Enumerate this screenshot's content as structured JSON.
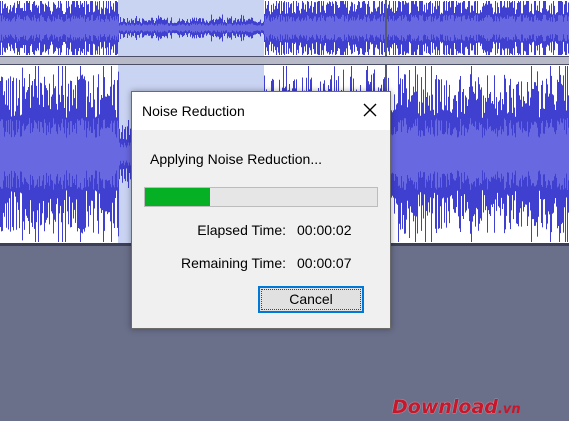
{
  "dialog": {
    "title": "Noise Reduction",
    "message": "Applying Noise Reduction...",
    "progress_fraction": 0.28,
    "elapsed_label": "Elapsed Time:",
    "elapsed_value": "00:00:02",
    "remaining_label": "Remaining Time:",
    "remaining_value": "00:00:07",
    "cancel_label": "Cancel",
    "close_icon": "close-icon"
  },
  "waveform": {
    "wave_color": "#3f3fd0",
    "rms_color": "#6868e0",
    "selection_color": "#c9d4f2",
    "background_color": "#ffffff"
  },
  "watermark": {
    "main": "Download",
    "tld": ".vn"
  }
}
